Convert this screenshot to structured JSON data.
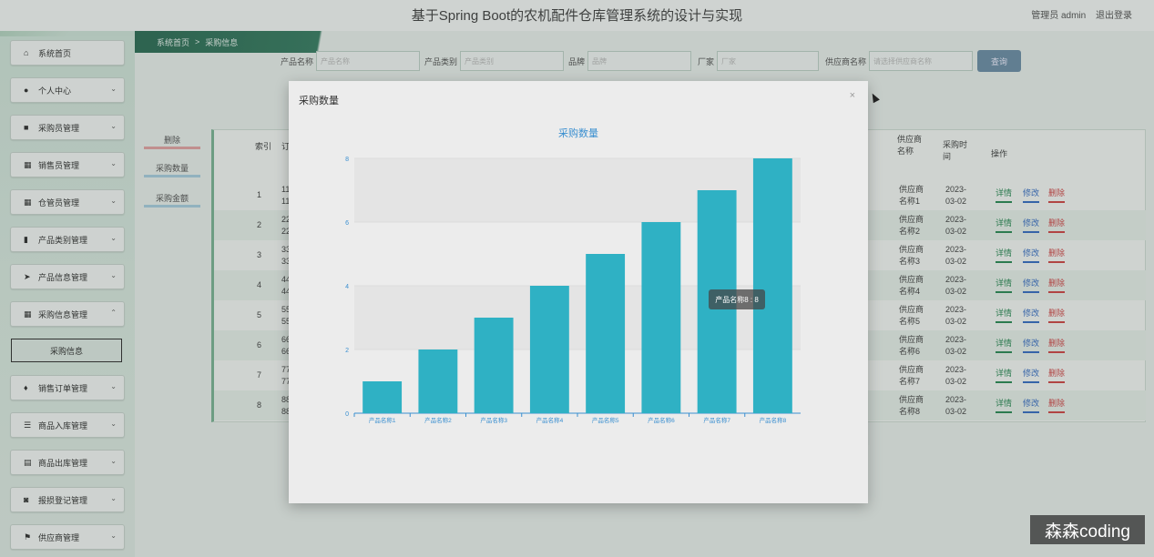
{
  "header": {
    "title": "基于Spring Boot的农机配件仓库管理系统的设计与实现",
    "user_label": "管理员 admin",
    "logout_label": "退出登录"
  },
  "sidebar": {
    "items": [
      {
        "label": "系统首页",
        "icon": "home-icon"
      },
      {
        "label": "个人中心",
        "icon": "user-icon"
      },
      {
        "label": "采购员管理",
        "icon": "briefcase-icon"
      },
      {
        "label": "销售员管理",
        "icon": "grid-icon"
      },
      {
        "label": "仓管员管理",
        "icon": "grid-icon"
      },
      {
        "label": "产品类别管理",
        "icon": "bar-chart-icon"
      },
      {
        "label": "产品信息管理",
        "icon": "send-icon"
      },
      {
        "label": "采购信息管理",
        "icon": "grid-icon"
      },
      {
        "label": "销售订单管理",
        "icon": "trophy-icon"
      },
      {
        "label": "商品入库管理",
        "icon": "sliders-icon"
      },
      {
        "label": "商品出库管理",
        "icon": "table-icon"
      },
      {
        "label": "报损登记管理",
        "icon": "camera-icon"
      },
      {
        "label": "供应商管理",
        "icon": "flag-icon"
      }
    ],
    "sub_item": "采购信息"
  },
  "breadcrumb": {
    "home": "系统首页",
    "separator": ">",
    "current": "采购信息"
  },
  "search": {
    "fields": [
      {
        "label": "产品名称",
        "placeholder": "产品名称"
      },
      {
        "label": "产品类别",
        "placeholder": "产品类别"
      },
      {
        "label": "品牌",
        "placeholder": "品牌"
      },
      {
        "label": "厂家",
        "placeholder": "厂家"
      },
      {
        "label": "供应商名称",
        "placeholder": "请选择供应商名称"
      }
    ],
    "query_label": "查询"
  },
  "side_tabs": [
    "删除",
    "采购数量",
    "采购金额"
  ],
  "table": {
    "headers": {
      "index": "索引",
      "order": "订单号",
      "supplier": "供应商名称",
      "time": "采购时间",
      "ops": "操作"
    },
    "rows": [
      {
        "index": "1",
        "order_a": "11",
        "order_b": "11",
        "supplier_a": "供应商",
        "supplier_b": "名称1",
        "date_a": "2023-",
        "date_b": "03-02"
      },
      {
        "index": "2",
        "order_a": "22",
        "order_b": "22",
        "supplier_a": "供应商",
        "supplier_b": "名称2",
        "date_a": "2023-",
        "date_b": "03-02"
      },
      {
        "index": "3",
        "order_a": "33",
        "order_b": "33",
        "supplier_a": "供应商",
        "supplier_b": "名称3",
        "date_a": "2023-",
        "date_b": "03-02"
      },
      {
        "index": "4",
        "order_a": "44",
        "order_b": "44",
        "supplier_a": "供应商",
        "supplier_b": "名称4",
        "date_a": "2023-",
        "date_b": "03-02"
      },
      {
        "index": "5",
        "order_a": "55",
        "order_b": "55",
        "supplier_a": "供应商",
        "supplier_b": "名称5",
        "date_a": "2023-",
        "date_b": "03-02"
      },
      {
        "index": "6",
        "order_a": "66",
        "order_b": "66",
        "supplier_a": "供应商",
        "supplier_b": "名称6",
        "date_a": "2023-",
        "date_b": "03-02"
      },
      {
        "index": "7",
        "order_a": "77",
        "order_b": "77",
        "supplier_a": "供应商",
        "supplier_b": "名称7",
        "date_a": "2023-",
        "date_b": "03-02"
      },
      {
        "index": "8",
        "order_a": "88",
        "order_b": "88",
        "supplier_a": "供应商",
        "supplier_b": "名称8",
        "date_a": "2023-",
        "date_b": "03-02"
      }
    ],
    "actions": {
      "detail": "详情",
      "edit": "修改",
      "delete": "删除"
    }
  },
  "modal": {
    "title": "采购数量",
    "close": "×"
  },
  "chart_data": {
    "type": "bar",
    "title": "采购数量",
    "categories": [
      "产品名称1",
      "产品名称2",
      "产品名称3",
      "产品名称4",
      "产品名称5",
      "产品名称6",
      "产品名称7",
      "产品名称8"
    ],
    "values": [
      1,
      2,
      3,
      4,
      5,
      6,
      7,
      8
    ],
    "ylim": [
      0,
      8
    ],
    "yticks": [
      "0",
      "2",
      "4",
      "6",
      "8"
    ],
    "color": "#2fb1c4",
    "tooltip": "产品名称8 : 8"
  },
  "watermark": "森森coding"
}
